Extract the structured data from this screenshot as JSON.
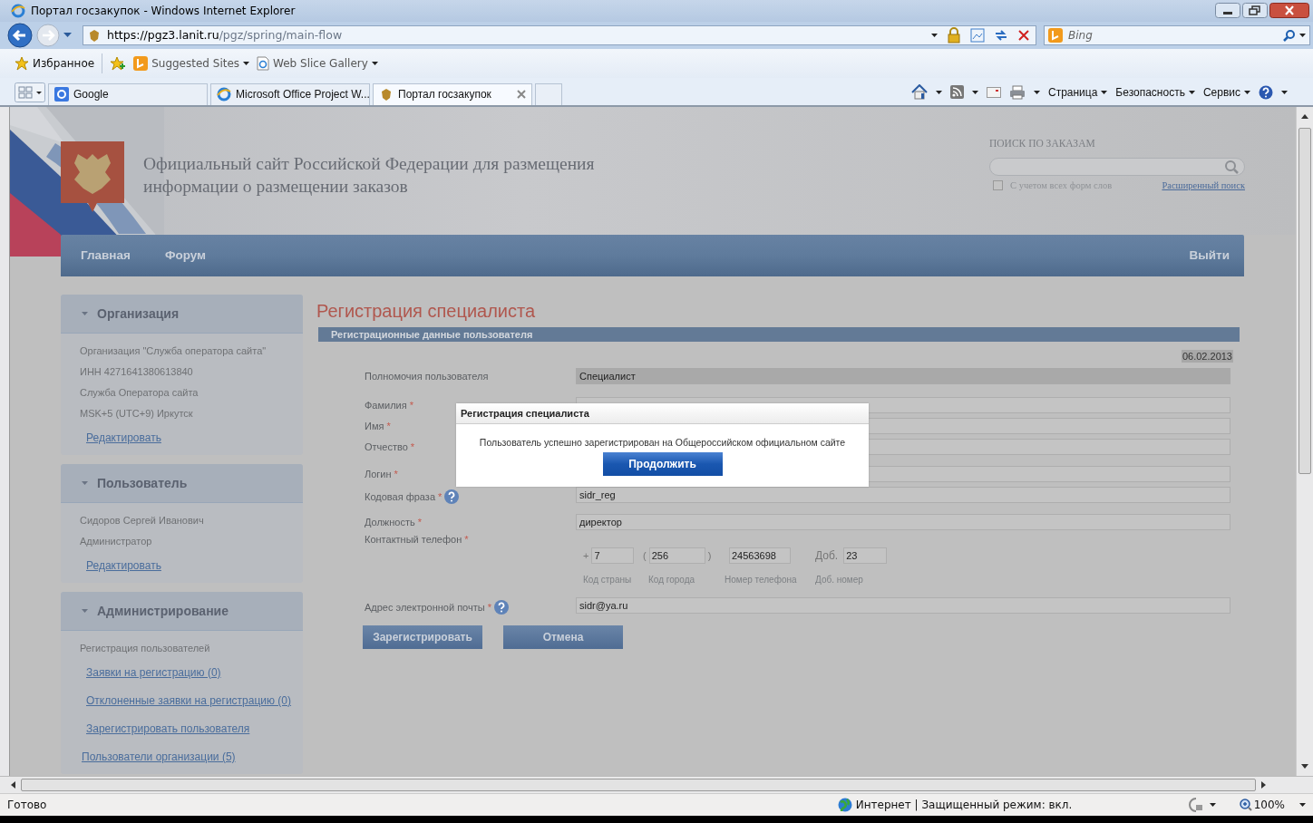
{
  "window": {
    "title": "Портал госзакупок - Windows Internet Explorer"
  },
  "address_bar": {
    "url_host": "https://pgz3.lanit.ru",
    "url_path": "/pgz/spring/main-flow",
    "search_placeholder": "Bing"
  },
  "favorites_bar": {
    "favorites": "Избранное",
    "items": [
      "Suggested Sites",
      "Web Slice Gallery"
    ]
  },
  "tabs": [
    {
      "label": "Google",
      "selected": false
    },
    {
      "label": "Microsoft Office Project W...",
      "selected": false
    },
    {
      "label": "Портал госзакупок",
      "selected": true
    }
  ],
  "command_bar": [
    "Страница",
    "Безопасность",
    "Сервис"
  ],
  "site_header": {
    "title": "Официальный сайт Российской Федерации для размещения информации о размещении заказов",
    "search_label": "ПОИСК ПО ЗАКАЗАМ",
    "word_forms": {
      "label": "С учетом всех форм слов",
      "checked": false
    },
    "advanced_link": "Расширенный поиск"
  },
  "nav": {
    "items": [
      "Главная",
      "Форум"
    ],
    "logout": "Выйти"
  },
  "sidebar": {
    "sections": [
      {
        "title": "Организация",
        "items": [
          {
            "kind": "text",
            "text": "Организация \"Служба оператора сайта\""
          },
          {
            "kind": "text",
            "text": "ИНН 4271641380613840"
          },
          {
            "kind": "text",
            "text": "Служба Оператора сайта"
          },
          {
            "kind": "text",
            "text": "MSK+5 (UTC+9) Иркутск"
          },
          {
            "kind": "link",
            "text": "Редактировать"
          }
        ]
      },
      {
        "title": "Пользователь",
        "items": [
          {
            "kind": "text",
            "text": "Сидоров Сергей Иванович"
          },
          {
            "kind": "text",
            "text": "Администратор"
          },
          {
            "kind": "link",
            "text": "Редактировать"
          }
        ]
      },
      {
        "title": "Администрирование",
        "items": [
          {
            "kind": "text",
            "text": "Регистрация пользователей"
          },
          {
            "kind": "link",
            "text": "Заявки на регистрацию (0)"
          },
          {
            "kind": "link",
            "text": "Отклоненные заявки на регистрацию (0)"
          },
          {
            "kind": "link",
            "text": "Зарегистрировать пользователя"
          },
          {
            "kind": "toplink",
            "text": "Пользователи организации (5)"
          }
        ]
      }
    ]
  },
  "main": {
    "title": "Регистрация специалиста",
    "section": "Регистрационные данные пользователя",
    "date": "06.02.2013",
    "fields": [
      {
        "kind": "readonly",
        "label": "Полномочия пользователя",
        "help": false,
        "value": "Специалист"
      },
      {
        "kind": "input",
        "label": "Фамилия",
        "required_mark": "*",
        "help": false
      },
      {
        "kind": "input",
        "label": "Имя",
        "required_mark": "*",
        "help": false
      },
      {
        "kind": "input",
        "label": "Отчество",
        "required_mark": "*",
        "help": false
      },
      {
        "kind": "input",
        "label": "Логин",
        "required_mark": "*",
        "help": false
      },
      {
        "kind": "input",
        "label": "Кодовая фраза",
        "required_mark": "*",
        "help": true,
        "value": "sidr_reg"
      },
      {
        "kind": "input",
        "label": "Должность",
        "required_mark": "*",
        "help": false,
        "value": "директор"
      },
      {
        "kind": "phone",
        "label": "Контактный телефон",
        "required_mark": "*",
        "help": false,
        "parts": [
          {
            "prefix": "+",
            "value": "7",
            "caption": "Код страны"
          },
          {
            "prefix": "(",
            "value": "256",
            "suffix": ")",
            "caption": "Код города"
          },
          {
            "value": "24563698",
            "caption": "Номер телефона"
          },
          {
            "prefix": "Доб.",
            "value": "23",
            "caption": "Доб. номер"
          }
        ]
      },
      {
        "kind": "input",
        "label": "Адрес электронной почты",
        "required_mark": "*",
        "help": true,
        "value": "sidr@ya.ru"
      }
    ],
    "buttons": [
      "Зарегистрировать",
      "Отмена"
    ]
  },
  "dialog": {
    "title": "Регистрация специалиста",
    "message": "Пользователь успешно зарегистрирован на Общероссийском официальном сайте",
    "button": "Продолжить"
  },
  "status_bar": {
    "text": "Готово",
    "zone": "Интернет | Защищенный режим: вкл.",
    "zoom": "100%"
  }
}
